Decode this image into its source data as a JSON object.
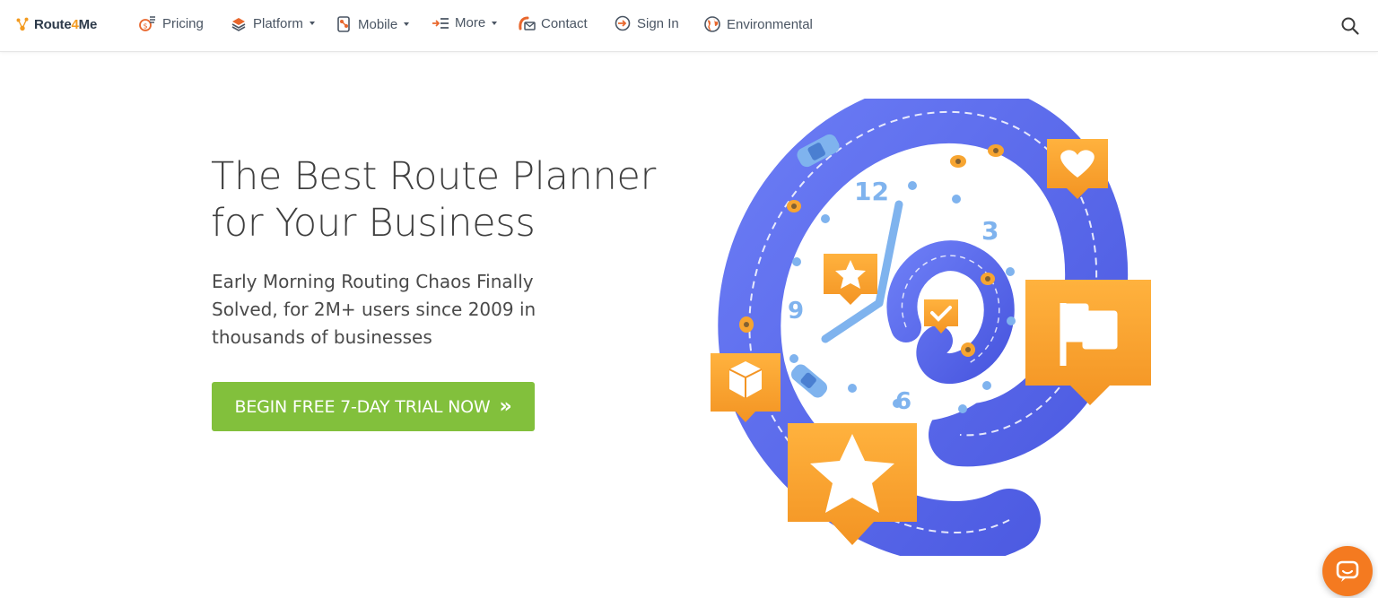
{
  "nav": {
    "brand_prefix": "Route",
    "brand_four": "4",
    "brand_suffix": "Me",
    "items": [
      {
        "label": "Pricing",
        "icon": "pricing-icon",
        "dropdown": false
      },
      {
        "label": "Platform",
        "icon": "platform-icon",
        "dropdown": true
      },
      {
        "label": "Mobile",
        "icon": "mobile-icon",
        "dropdown": true
      },
      {
        "label": "More",
        "icon": "more-icon",
        "dropdown": true
      },
      {
        "label": "Contact",
        "icon": "contact-icon",
        "dropdown": false
      },
      {
        "label": "Sign In",
        "icon": "sign-in-icon",
        "dropdown": false
      },
      {
        "label": "Environmental",
        "icon": "globe-icon",
        "dropdown": false
      }
    ],
    "search_icon": "search-icon"
  },
  "hero": {
    "title_line1": "The Best Route Planner",
    "title_line2": "for Your Business",
    "subtitle_line1": "Early Morning Routing Chaos Finally",
    "subtitle_line2": "Solved, for 2M+ users since 2009 in",
    "subtitle_line3": "thousands of businesses",
    "cta_label": "BEGIN FREE 7-DAY TRIAL NOW",
    "cta_chevron": "»"
  },
  "illustration": {
    "clock_numbers": [
      "12",
      "3",
      "9",
      "6"
    ],
    "colors": {
      "spiral": "#5b6cf0",
      "accent": "#f7a531",
      "cta": "#82c03c",
      "chat": "#f47a20"
    }
  },
  "chat": {
    "icon": "chat-bubble-icon"
  }
}
